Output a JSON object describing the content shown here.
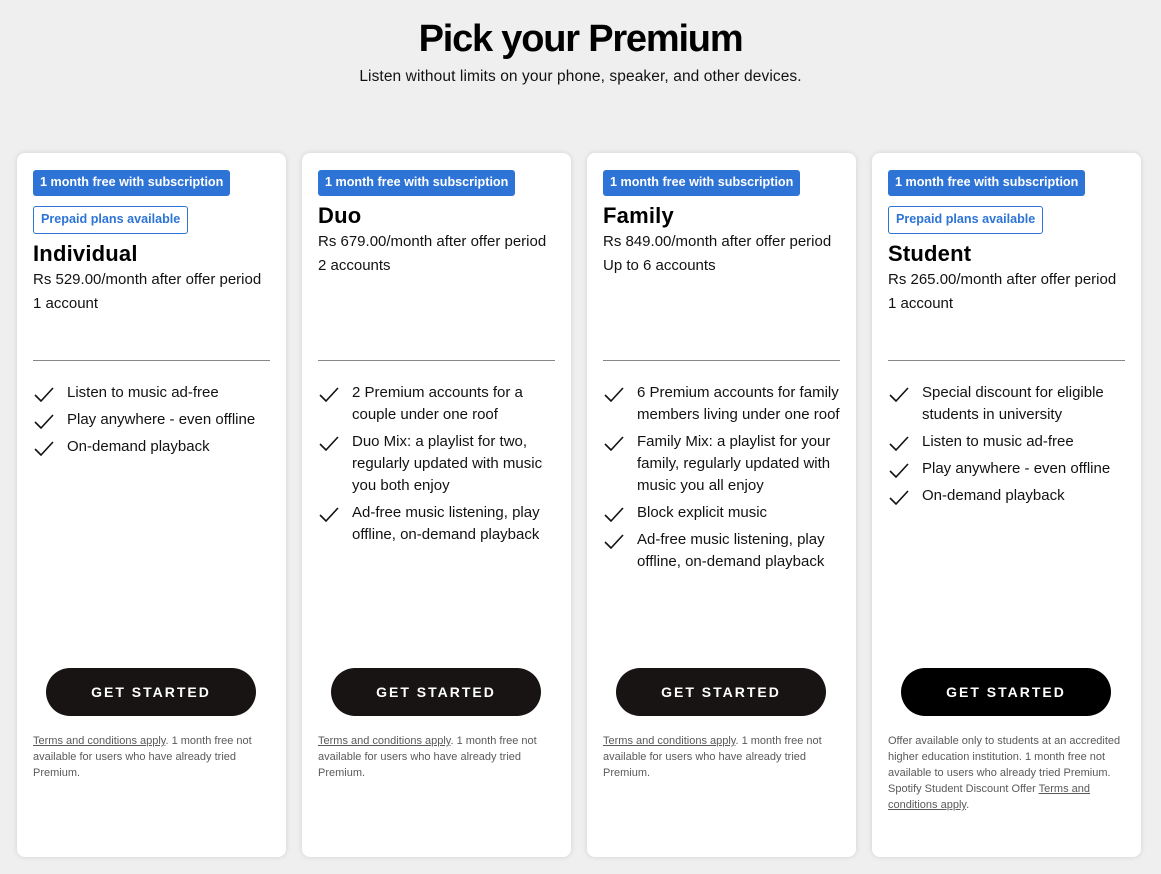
{
  "header": {
    "title": "Pick your Premium",
    "subtitle": "Listen without limits on your phone, speaker, and other devices."
  },
  "colors": {
    "badge_blue": "#2d74d6",
    "button_dark": "#191414",
    "background": "#efefef"
  },
  "plans": [
    {
      "badge": "1 month free with subscription",
      "prepaid": "Prepaid plans available",
      "name": "Individual",
      "price": "Rs 529.00/month after offer period",
      "accounts": "1 account",
      "features": [
        "Listen to music ad-free",
        "Play anywhere - even offline",
        "On-demand playback"
      ],
      "cta": "GET STARTED",
      "terms_link": "Terms and conditions apply",
      "terms_text": ". 1 month free not available for users who have already tried Premium."
    },
    {
      "badge": "1 month free with subscription",
      "name": "Duo",
      "price": "Rs 679.00/month after offer period",
      "accounts": "2 accounts",
      "features": [
        "2 Premium accounts for a couple under one roof",
        "Duo Mix: a playlist for two, regularly updated with music you both enjoy",
        "Ad-free music listening, play offline, on-demand playback"
      ],
      "cta": "GET STARTED",
      "terms_link": "Terms and conditions apply",
      "terms_text": ". 1 month free not available for users who have already tried Premium."
    },
    {
      "badge": "1 month free with subscription",
      "name": "Family",
      "price": "Rs 849.00/month after offer period",
      "accounts": "Up to 6 accounts",
      "features": [
        "6 Premium accounts for family members living under one roof",
        "Family Mix: a playlist for your family, regularly updated with music you all enjoy",
        "Block explicit music",
        "Ad-free music listening, play offline, on-demand playback"
      ],
      "cta": "GET STARTED",
      "terms_link": "Terms and conditions apply",
      "terms_text": ". 1 month free not available for users who have already tried Premium."
    },
    {
      "badge": "1 month free with subscription",
      "prepaid": "Prepaid plans available",
      "name": "Student",
      "price": "Rs 265.00/month after offer period",
      "accounts": "1 account",
      "features": [
        "Special discount for eligible students in university",
        "Listen to music ad-free",
        "Play anywhere - even offline",
        "On-demand playback"
      ],
      "cta": "GET STARTED",
      "terms_pre": "Offer available only to students at an accredited higher education institution. 1 month free not available to users who already tried Premium. Spotify Student Discount Offer ",
      "terms_link": "Terms and conditions apply",
      "terms_text": "."
    }
  ]
}
